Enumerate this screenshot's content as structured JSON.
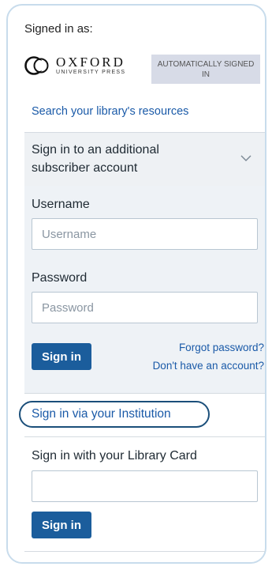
{
  "signed_in": {
    "label": "Signed in as:",
    "org_name": "OXFORD",
    "org_sub": "UNIVERSITY PRESS",
    "badge": "AUTOMATICALLY SIGNED IN"
  },
  "search_link": "Search your library's resources",
  "accordion": {
    "label": "Sign in to an additional subscriber account",
    "icon": "chevron-down-icon"
  },
  "form": {
    "username_label": "Username",
    "username_placeholder": "Username",
    "password_label": "Password",
    "password_placeholder": "Password",
    "signin_button": "Sign in",
    "forgot_password": "Forgot password?",
    "no_account": "Don't have an account?"
  },
  "institution_link": "Sign in via your Institution",
  "library_card": {
    "heading": "Sign in with your Library Card",
    "card_value": "",
    "signin_button": "Sign in"
  },
  "colors": {
    "link": "#1a5aa8",
    "button": "#1b5d9c",
    "badge_bg": "#d7dbe7",
    "panel_border": "#c8dcec",
    "highlight_ring": "#1b4f7a"
  }
}
